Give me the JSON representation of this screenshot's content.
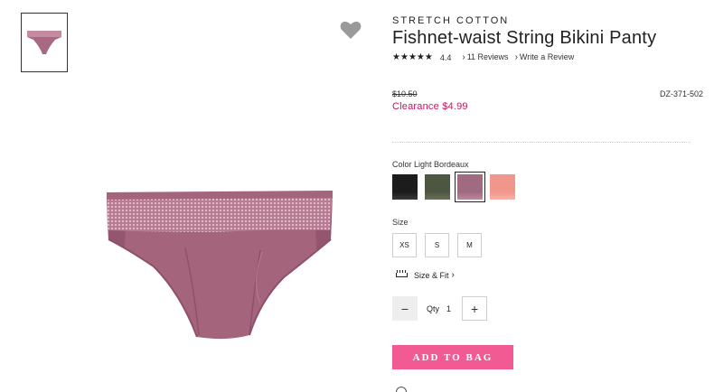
{
  "product": {
    "brand": "STRETCH COTTON",
    "title": "Fishnet-waist String Bikini Panty",
    "rating": "4.4",
    "reviews_link": "11 Reviews",
    "write_review_link": "Write a Review",
    "original_price": "$10.50",
    "sale_price": "Clearance $4.99",
    "sku": "DZ-371-502"
  },
  "color": {
    "label": "Color Light Bordeaux",
    "swatches": [
      {
        "name": "black",
        "color": "#1c1c1c"
      },
      {
        "name": "olive",
        "color": "#4d5640"
      },
      {
        "name": "light-bordeaux",
        "color": "#a06a80"
      },
      {
        "name": "peach",
        "color": "#f0968a"
      }
    ]
  },
  "size": {
    "label": "Size",
    "options": [
      "XS",
      "S",
      "M"
    ],
    "fit_link": "Size & Fit"
  },
  "quantity": {
    "label": "Qty",
    "value": "1",
    "minus": "−",
    "plus": "+"
  },
  "cart": {
    "add_label": "ADD TO BAG"
  },
  "icons": {
    "favorite": "heart-icon",
    "ruler": "ruler-icon",
    "chevron": "chevron-right-icon"
  },
  "colors": {
    "accent_pink": "#f25a93",
    "sale_red": "#c2185b",
    "product_mauve": "#a86a82"
  }
}
